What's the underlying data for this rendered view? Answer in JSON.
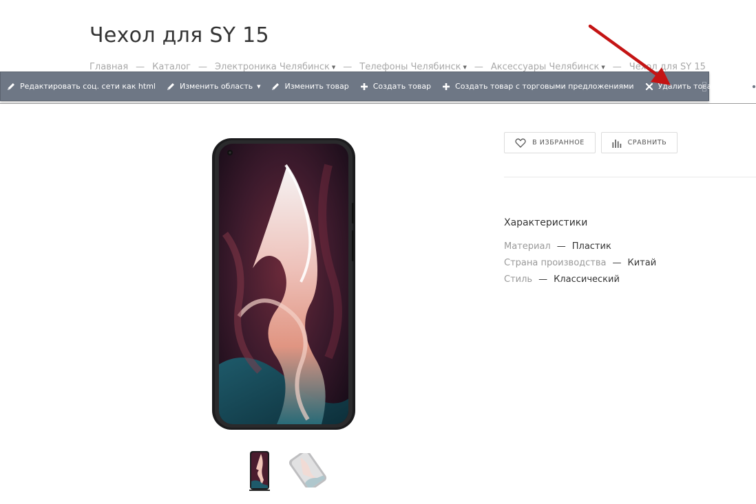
{
  "page": {
    "title": "Чехол для SY 15"
  },
  "breadcrumb": {
    "items": [
      {
        "label": "Главная",
        "dropdown": false
      },
      {
        "label": "Каталог",
        "dropdown": false
      },
      {
        "label": "Электроника Челябинск",
        "dropdown": true
      },
      {
        "label": "Телефоны Челябинск",
        "dropdown": true
      },
      {
        "label": "Аксессуары Челябинск",
        "dropdown": true
      },
      {
        "label": "Чехол для SY 15",
        "dropdown": false
      }
    ],
    "separator": "—"
  },
  "admin_toolbar": {
    "buttons": [
      {
        "label": "Редактировать соц. сети как html",
        "icon": "pencil-icon"
      },
      {
        "label": "Изменить область",
        "icon": "pencil-icon",
        "dropdown": true
      },
      {
        "label": "Изменить товар",
        "icon": "pencil-icon"
      },
      {
        "label": "Создать товар",
        "icon": "plus-icon"
      },
      {
        "label": "Создать товар с торговыми предложениями",
        "icon": "plus-icon"
      },
      {
        "label": "Удалить товар",
        "icon": "close-icon"
      }
    ],
    "pin_icon": "pin-icon",
    "settings_icon": "gear-icon",
    "background_color": "#6e7785"
  },
  "product": {
    "image_icon": "phone-case-image",
    "thumbnails": [
      "phone-case-front-thumbnail",
      "phone-case-angled-thumbnail"
    ]
  },
  "actions": {
    "favorite_label": "В ИЗБРАННОЕ",
    "compare_label": "СРАВНИТЬ"
  },
  "specs": {
    "title": "Характеристики",
    "separator": "—",
    "rows": [
      {
        "key": "Материал",
        "value": "Пластик"
      },
      {
        "key": "Страна производства",
        "value": "Китай"
      },
      {
        "key": "Стиль",
        "value": "Классический"
      }
    ]
  },
  "annotation": {
    "arrow_color": "#cc1111"
  }
}
